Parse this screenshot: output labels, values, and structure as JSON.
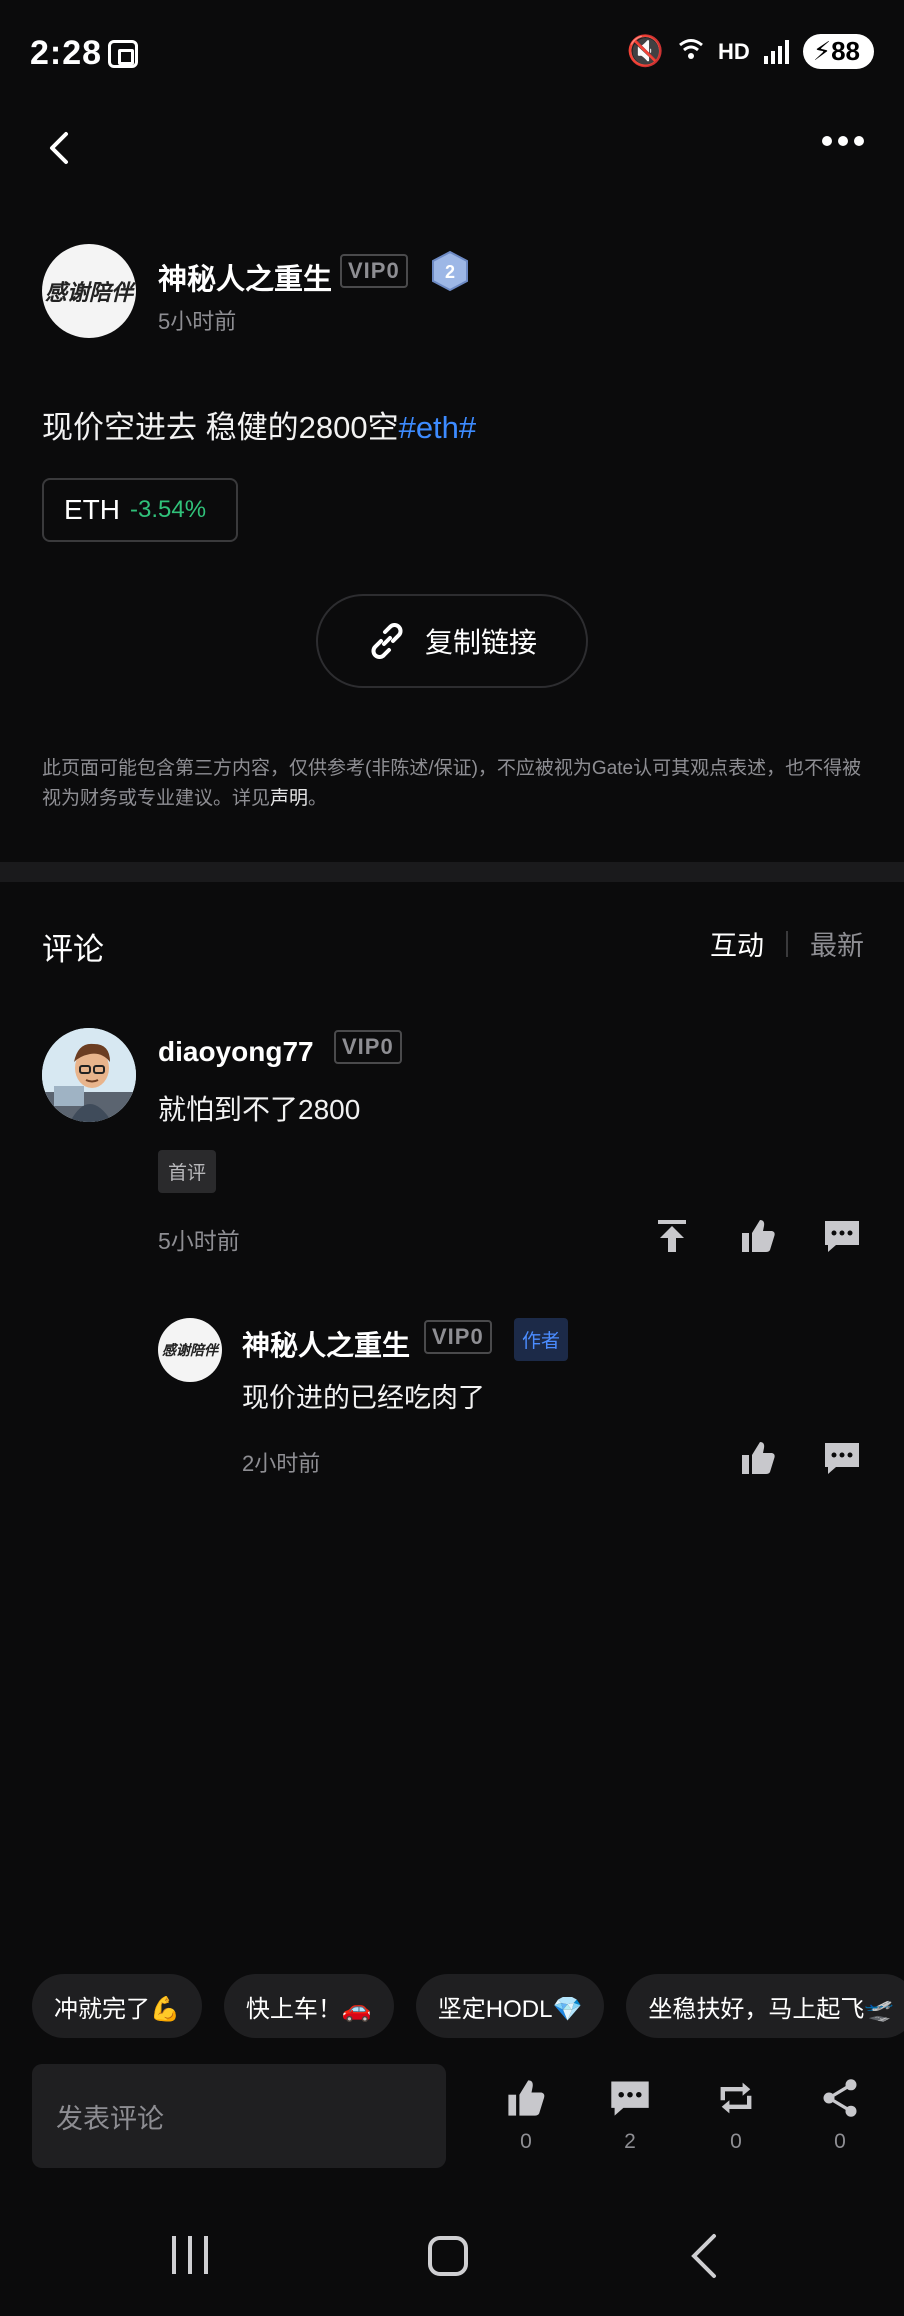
{
  "status_bar": {
    "time": "2:28",
    "network": "HD",
    "battery": "88"
  },
  "author": {
    "name": "神秘人之重生",
    "vip": "VIP0",
    "level": "2",
    "time": "5小时前",
    "avatar_text": "感谢陪伴"
  },
  "post": {
    "text": "现价空进去 稳健的2800空",
    "hashtag": "#eth#"
  },
  "coin": {
    "name": "ETH",
    "change": "-3.54%",
    "change_color": "#30c27a"
  },
  "copy_link_label": "复制链接",
  "disclaimer": {
    "text": "此页面可能包含第三方内容，仅供参考(非陈述/保证)，不应被视为Gate认可其观点表述，也不得被视为财务或专业建议。详见",
    "link": "声明",
    "tail": "。"
  },
  "comments": {
    "title": "评论",
    "sort": {
      "active": "互动",
      "inactive": "最新"
    },
    "items": [
      {
        "user": "diaoyong77",
        "vip": "VIP0",
        "text": "就怕到不了2800",
        "tag": "首评",
        "time": "5小时前",
        "reply": {
          "user": "神秘人之重生",
          "vip": "VIP0",
          "author_tag": "作者",
          "text": "现价进的已经吃肉了",
          "time": "2小时前"
        }
      }
    ]
  },
  "quick_replies": [
    "冲就完了💪",
    "快上车！🚗",
    "坚定HODL💎",
    "坐稳扶好，马上起飞🛫"
  ],
  "bottom_bar": {
    "comment_placeholder": "发表评论",
    "like_count": "0",
    "comment_count": "2",
    "repost_count": "0",
    "share_count": "0"
  },
  "colors": {
    "accent": "#3d8bff",
    "background": "#0b0b0c",
    "positive": "#30c27a"
  }
}
